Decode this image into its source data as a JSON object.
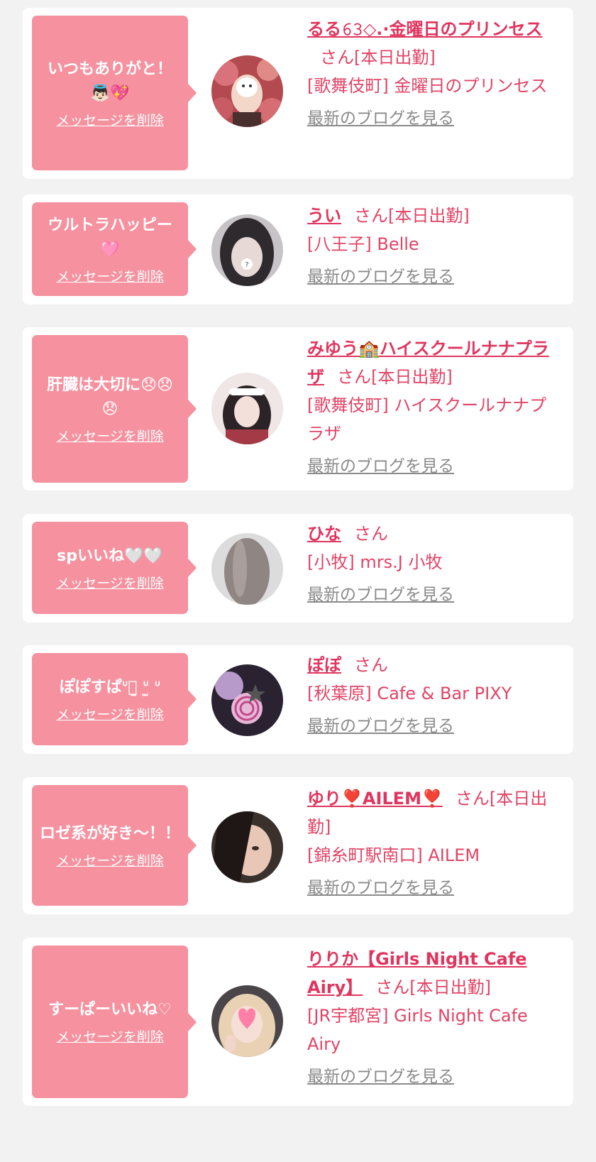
{
  "ui": {
    "delete_label": "メッセージを削除",
    "blog_label": "最新のブログを見る",
    "accent_pink": "#f6919f",
    "name_color": "#e0355e"
  },
  "cards": [
    {
      "message": "いつもありがと！👼🏻💖",
      "name": "るる𝟼𝟹◇.·金曜日のプリンセス",
      "status": "さん[本日出勤]",
      "shop": "[歌舞伎町] 金曜日のプリンセス"
    },
    {
      "message": "ウルトラハッピー🩷",
      "name": "うい",
      "status": "さん[本日出勤]",
      "shop": "[八王子] Belle"
    },
    {
      "message": "肝臓は大切に😞😞😞",
      "name": "みゆう🏫ハイスクールナナプラザ",
      "status": "さん[本日出勤]",
      "shop": "[歌舞伎町] ハイスクールナナプラザ"
    },
    {
      "message": "spいいね🤍🤍",
      "name": "ひな",
      "status": "さん",
      "shop": "[小牧] mrs.J 小牧"
    },
    {
      "message": "ぽぽすぱᐡっ̫ ᐡ̫ ᐡ",
      "name": "ぽぽ",
      "status": "さん",
      "shop": "[秋葉原] Cafe & Bar PIXY"
    },
    {
      "message": "ロゼ系が好き〜！！",
      "name": "ゆり❣️AILEM❣️",
      "status": "さん[本日出勤]",
      "shop": "[錦糸町駅南口] AILEM"
    },
    {
      "message": "すーぱーいいね♡",
      "name": "りりか【Girls Night Cafe Airy】",
      "status": "さん[本日出勤]",
      "shop": "[JR宇都宮] Girls Night Cafe Airy"
    }
  ]
}
